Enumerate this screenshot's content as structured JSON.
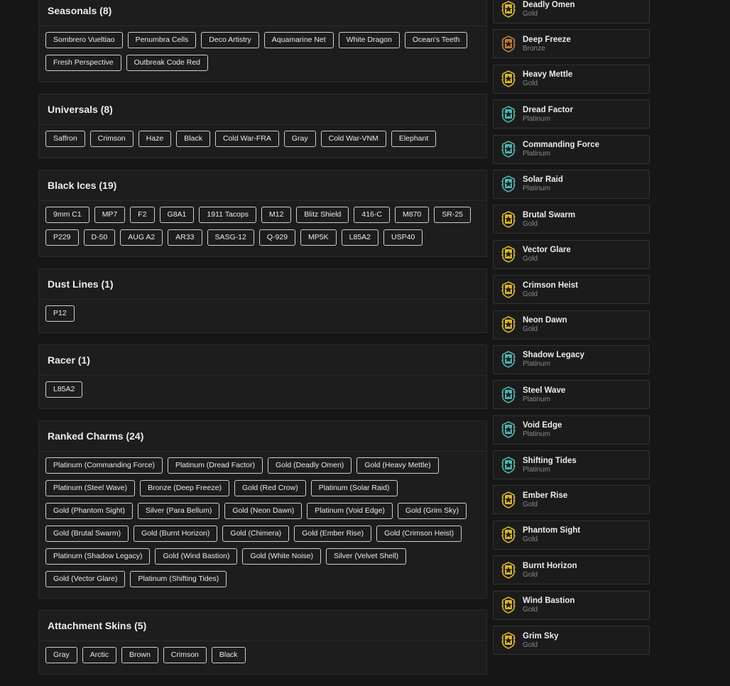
{
  "sections": [
    {
      "title": "Seasonals (8)",
      "items": [
        "Sombrero Vueltiao",
        "Penumbra Cells",
        "Deco Artistry",
        "Aquamarine Net",
        "White Dragon",
        "Ocean's Teeth",
        "Fresh Perspective",
        "Outbreak Code Red"
      ]
    },
    {
      "title": "Universals (8)",
      "items": [
        "Saffron",
        "Crimson",
        "Haze",
        "Black",
        "Cold War-FRA",
        "Gray",
        "Cold War-VNM",
        "Elephant"
      ]
    },
    {
      "title": "Black Ices (19)",
      "items": [
        "9mm C1",
        "MP7",
        "F2",
        "G8A1",
        "1911 Tacops",
        "M12",
        "Blitz Shield",
        "416-C",
        "M870",
        "SR-25",
        "P229",
        "D-50",
        "AUG A2",
        "AR33",
        "SASG-12",
        "Q-929",
        "MP5K",
        "L85A2",
        "USP40"
      ]
    },
    {
      "title": "Dust Lines (1)",
      "items": [
        "P12"
      ]
    },
    {
      "title": "Racer (1)",
      "items": [
        "L85A2"
      ]
    },
    {
      "title": "Ranked Charms (24)",
      "items": [
        "Platinum (Commanding Force)",
        "Platinum (Dread Factor)",
        "Gold (Deadly Omen)",
        "Gold (Heavy Mettle)",
        "Platinum (Steel Wave)",
        "Bronze (Deep Freeze)",
        "Gold (Red Crow)",
        "Platinum (Solar Raid)",
        "Gold (Phantom Sight)",
        "Silver (Para Bellum)",
        "Gold (Neon Dawn)",
        "Platinum (Void Edge)",
        "Gold (Grim Sky)",
        "Gold (Brutal Swarm)",
        "Gold (Burnt Horizon)",
        "Gold (Chimera)",
        "Gold (Ember Rise)",
        "Gold (Crimson Heist)",
        "Platinum (Shadow Legacy)",
        "Gold (Wind Bastion)",
        "Gold (White Noise)",
        "Silver (Velvet Shell)",
        "Gold (Vector Glare)",
        "Platinum (Shifting Tides)"
      ]
    },
    {
      "title": "Attachment Skins (5)",
      "items": [
        "Gray",
        "Arctic",
        "Brown",
        "Crimson",
        "Black"
      ]
    }
  ],
  "charms": [
    {
      "name": "Deadly Omen",
      "tier": "Gold"
    },
    {
      "name": "Deep Freeze",
      "tier": "Bronze"
    },
    {
      "name": "Heavy Mettle",
      "tier": "Gold"
    },
    {
      "name": "Dread Factor",
      "tier": "Platinum"
    },
    {
      "name": "Commanding Force",
      "tier": "Platinum"
    },
    {
      "name": "Solar Raid",
      "tier": "Platinum"
    },
    {
      "name": "Brutal Swarm",
      "tier": "Gold"
    },
    {
      "name": "Vector Glare",
      "tier": "Gold"
    },
    {
      "name": "Crimson Heist",
      "tier": "Gold"
    },
    {
      "name": "Neon Dawn",
      "tier": "Gold"
    },
    {
      "name": "Shadow Legacy",
      "tier": "Platinum"
    },
    {
      "name": "Steel Wave",
      "tier": "Platinum"
    },
    {
      "name": "Void Edge",
      "tier": "Platinum"
    },
    {
      "name": "Shifting Tides",
      "tier": "Platinum"
    },
    {
      "name": "Ember Rise",
      "tier": "Gold"
    },
    {
      "name": "Phantom Sight",
      "tier": "Gold"
    },
    {
      "name": "Burnt Horizon",
      "tier": "Gold"
    },
    {
      "name": "Wind Bastion",
      "tier": "Gold"
    },
    {
      "name": "Grim Sky",
      "tier": "Gold"
    }
  ],
  "tier_colors": {
    "Gold": "#d9b430",
    "Bronze": "#c27a3a",
    "Platinum": "#4fb3b0",
    "Silver": "#b8b8b8"
  },
  "icon": "rank-badge-icon"
}
